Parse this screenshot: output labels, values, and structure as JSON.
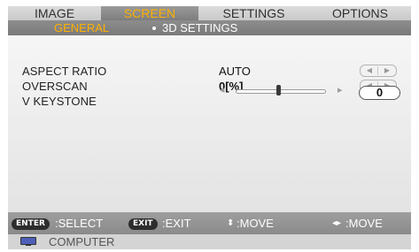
{
  "tabs": [
    {
      "label": "IMAGE"
    },
    {
      "label": "SCREEN"
    },
    {
      "label": "SETTINGS"
    },
    {
      "label": "OPTIONS"
    }
  ],
  "subtabs": [
    {
      "label": "GENERAL"
    },
    {
      "label": "3D SETTINGS"
    }
  ],
  "settings": {
    "aspect_ratio": {
      "label": "ASPECT RATIO",
      "value": "AUTO",
      "left_arrow": "◀",
      "right_arrow": "▶"
    },
    "overscan": {
      "label": "OVERSCAN",
      "value": "0[%]",
      "left_arrow": "◀",
      "right_arrow": "▶"
    },
    "v_keystone": {
      "label": "V KEYSTONE",
      "value": "0",
      "left_arrow": "◀",
      "right_arrow": "▶"
    }
  },
  "footer": {
    "enter_key": "ENTER",
    "select": ":SELECT",
    "exit_key": "EXIT",
    "exit": ":EXIT",
    "updown_icon": "⬍",
    "move_v": ":MOVE",
    "leftright_icon": "◂▸",
    "move_h": ":MOVE"
  },
  "source": {
    "label": "COMPUTER",
    "icon": "monitor-icon"
  },
  "colors": {
    "accent": "#ffb000",
    "active_tab": "#8a8a8a",
    "footer": "#939393"
  }
}
